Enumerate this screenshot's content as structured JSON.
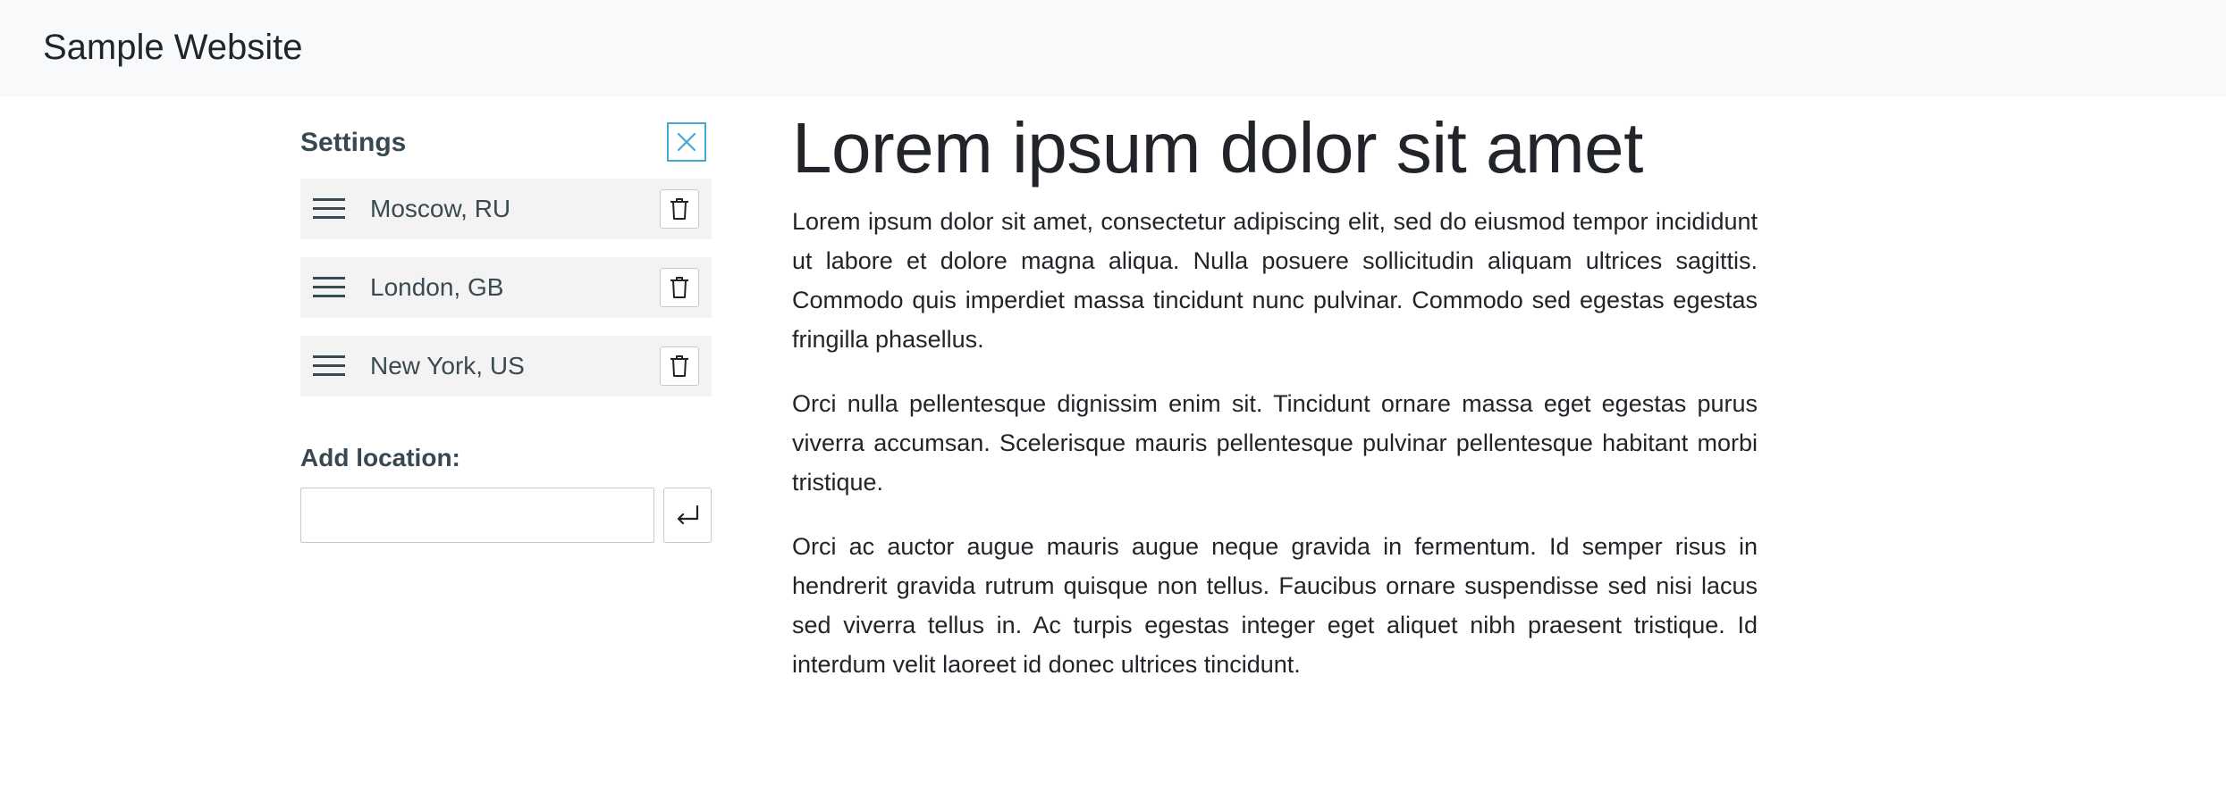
{
  "navbar": {
    "brand": "Sample Website"
  },
  "settings": {
    "title": "Settings",
    "close_icon": "close-icon",
    "accent_color": "#46a6d4",
    "locations": [
      {
        "label": "Moscow, RU"
      },
      {
        "label": "London, GB"
      },
      {
        "label": "New York, US"
      }
    ],
    "add_location": {
      "label": "Add location:",
      "value": "",
      "placeholder": "",
      "submit_icon": "enter-icon"
    }
  },
  "content": {
    "title": "Lorem ipsum dolor sit amet",
    "paragraphs": [
      "Lorem ipsum dolor sit amet, consectetur adipiscing elit, sed do eiusmod tempor incididunt ut labore et dolore magna aliqua. Nulla posuere sollicitudin aliquam ultrices sagittis. Commodo quis imperdiet massa tincidunt nunc pulvinar. Commodo sed egestas egestas fringilla phasellus.",
      "Orci nulla pellentesque dignissim enim sit. Tincidunt ornare massa eget egestas purus viverra accumsan. Scelerisque mauris pellentesque pulvinar pellentesque habitant morbi tristique.",
      "Orci ac auctor augue mauris augue neque gravida in fermentum. Id semper risus in hendrerit gravida rutrum quisque non tellus. Faucibus ornare suspendisse sed nisi lacus sed viverra tellus in. Ac turpis egestas integer eget aliquet nibh praesent tristique. Id interdum velit laoreet id donec ultrices tincidunt."
    ]
  }
}
